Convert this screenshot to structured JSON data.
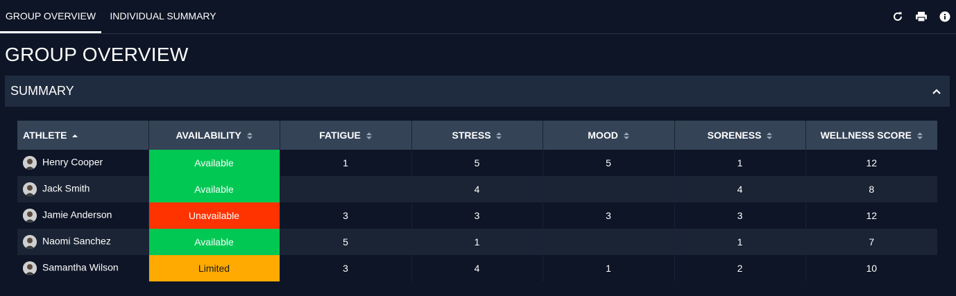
{
  "tabs": [
    {
      "label": "GROUP OVERVIEW",
      "active": true
    },
    {
      "label": "INDIVIDUAL SUMMARY",
      "active": false
    }
  ],
  "toolbar": {
    "refresh_icon": "refresh-icon",
    "print_icon": "print-icon",
    "info_icon": "info-icon"
  },
  "page_title": "GROUP OVERVIEW",
  "summary": {
    "title": "SUMMARY",
    "collapse_icon": "chevron-up-icon"
  },
  "table": {
    "columns": [
      "ATHLETE",
      "AVAILABILITY",
      "FATIGUE",
      "STRESS",
      "MOOD",
      "SORENESS",
      "WELLNESS SCORE"
    ],
    "sorted_column": "ATHLETE",
    "sort_direction": "asc",
    "rows": [
      {
        "athlete": "Henry Cooper",
        "availability": "Available",
        "fatigue": "1",
        "stress": "5",
        "mood": "5",
        "soreness": "1",
        "wellness": "12"
      },
      {
        "athlete": "Jack Smith",
        "availability": "Available",
        "fatigue": "",
        "stress": "4",
        "mood": "",
        "soreness": "4",
        "wellness": "8"
      },
      {
        "athlete": "Jamie Anderson",
        "availability": "Unavailable",
        "fatigue": "3",
        "stress": "3",
        "mood": "3",
        "soreness": "3",
        "wellness": "12"
      },
      {
        "athlete": "Naomi Sanchez",
        "availability": "Available",
        "fatigue": "5",
        "stress": "1",
        "mood": "",
        "soreness": "1",
        "wellness": "7"
      },
      {
        "athlete": "Samantha Wilson",
        "availability": "Limited",
        "fatigue": "3",
        "stress": "4",
        "mood": "1",
        "soreness": "2",
        "wellness": "10"
      }
    ]
  },
  "colors": {
    "background": "#0d1526",
    "panel_header": "#1f2b3e",
    "table_header": "#354357",
    "row_alt": "#1a2434",
    "Available": "#00c853",
    "Unavailable": "#ff3300",
    "Limited": "#ffaa00"
  }
}
